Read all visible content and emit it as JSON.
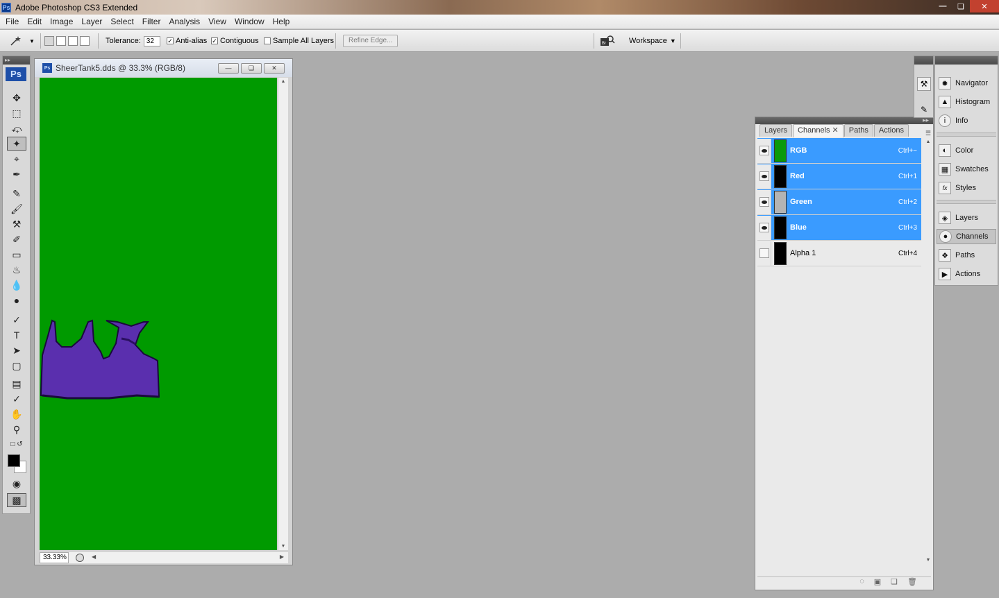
{
  "app": {
    "title": "Adobe Photoshop CS3 Extended"
  },
  "menu": [
    "File",
    "Edit",
    "Image",
    "Layer",
    "Select",
    "Filter",
    "Analysis",
    "View",
    "Window",
    "Help"
  ],
  "options": {
    "tolerance_label": "Tolerance:",
    "tolerance_value": "32",
    "antialias_label": "Anti-alias",
    "antialias_checked": true,
    "contiguous_label": "Contiguous",
    "contiguous_checked": true,
    "sample_all_label": "Sample All Layers",
    "sample_all_checked": false,
    "refine_edge": "Refine Edge...",
    "workspace": "Workspace"
  },
  "toolbox": {
    "badge": "Ps"
  },
  "document": {
    "title": "SheerTank5.dds @ 33.3% (RGB/8)",
    "zoom": "33.33%",
    "canvas_color": "#009a00",
    "garment_color": "#5a2fae"
  },
  "channels_panel": {
    "tabs": [
      {
        "label": "Layers",
        "active": false
      },
      {
        "label": "Channels",
        "active": true
      },
      {
        "label": "Paths",
        "active": false
      },
      {
        "label": "Actions",
        "active": false
      }
    ],
    "rows": [
      {
        "name": "RGB",
        "shortcut": "Ctrl+~",
        "selected": true,
        "visible": true,
        "thumb": "#0a9a0a"
      },
      {
        "name": "Red",
        "shortcut": "Ctrl+1",
        "selected": true,
        "visible": true,
        "thumb": "#000000"
      },
      {
        "name": "Green",
        "shortcut": "Ctrl+2",
        "selected": true,
        "visible": true,
        "thumb": "#b4b4b4"
      },
      {
        "name": "Blue",
        "shortcut": "Ctrl+3",
        "selected": true,
        "visible": true,
        "thumb": "#000000"
      },
      {
        "name": "Alpha 1",
        "shortcut": "Ctrl+4",
        "selected": false,
        "visible": false,
        "thumb": "#000000"
      }
    ]
  },
  "dock": {
    "groups": [
      [
        "Navigator",
        "Histogram",
        "Info"
      ],
      [
        "Color",
        "Swatches",
        "Styles"
      ],
      [
        "Layers",
        "Channels",
        "Paths",
        "Actions"
      ]
    ],
    "active": "Channels"
  },
  "colors": {
    "selection_blue": "#3a9bff",
    "close_red": "#c2412f"
  }
}
